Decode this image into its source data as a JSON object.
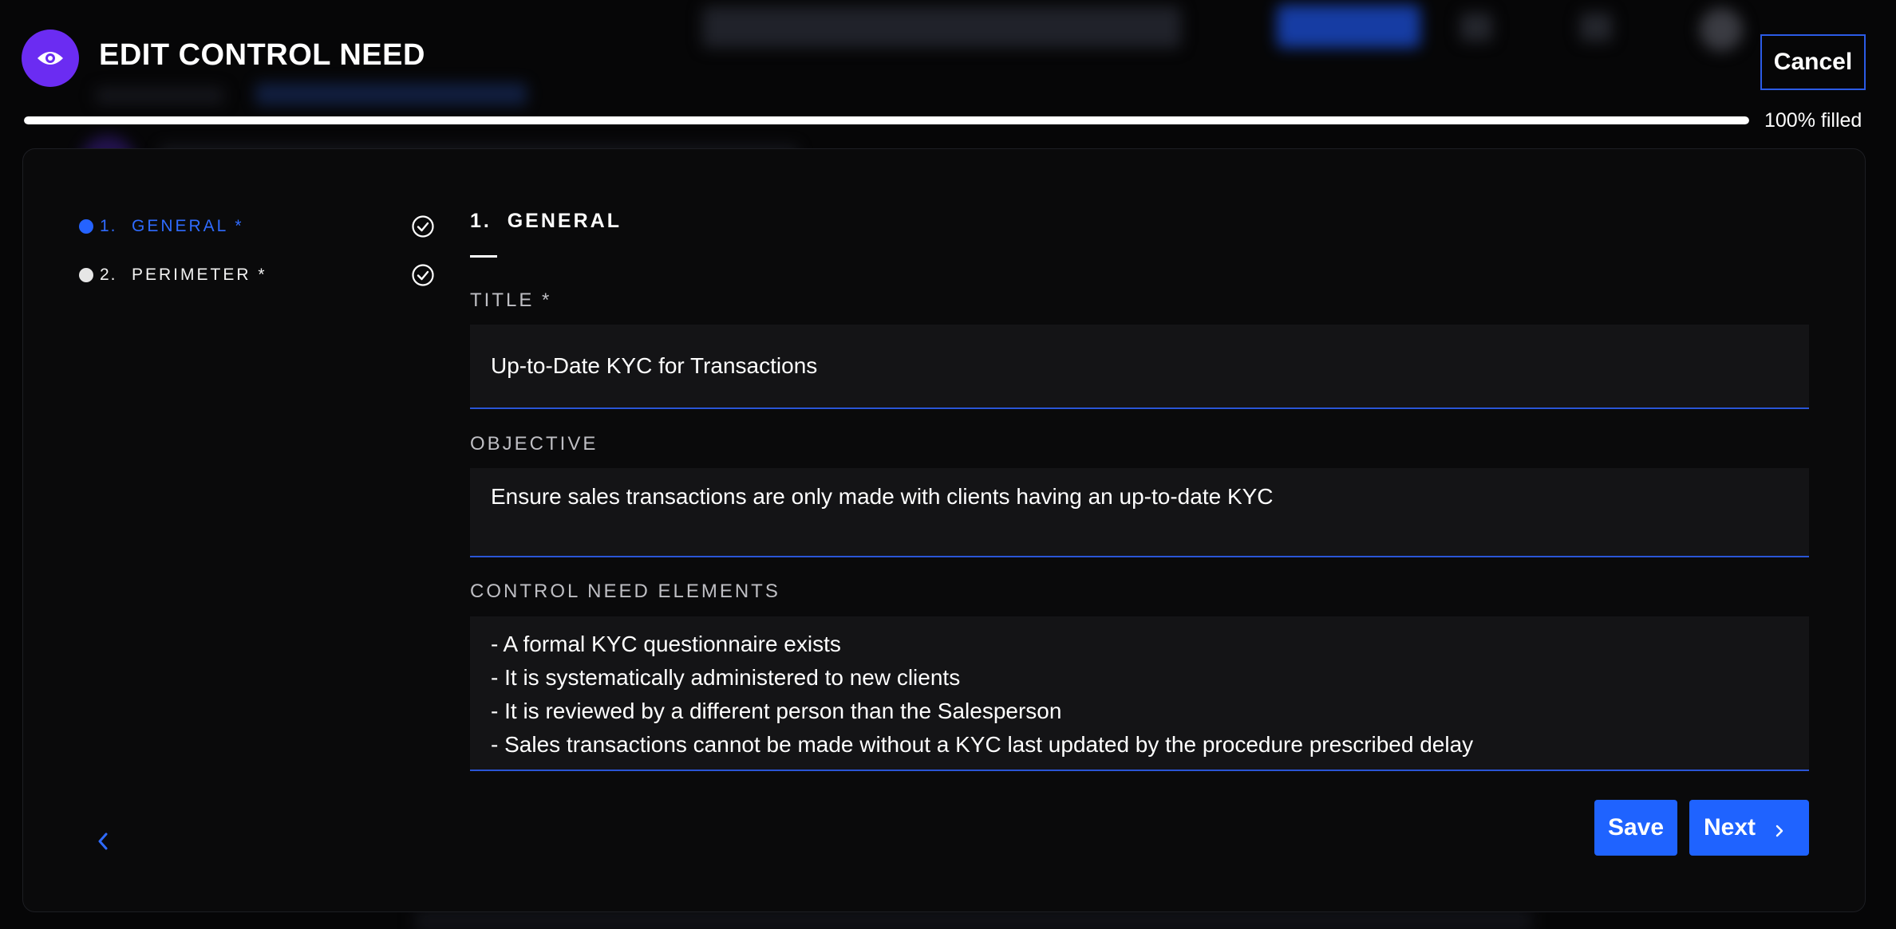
{
  "header": {
    "title": "EDIT CONTROL NEED",
    "icon": "eye-icon",
    "cancel_label": "Cancel"
  },
  "progress": {
    "fraction": 1.0,
    "label": "100% filled"
  },
  "steps": [
    {
      "number": "1.",
      "label": "GENERAL *",
      "active": true,
      "completed": true,
      "icon": "check-circle-icon"
    },
    {
      "number": "2.",
      "label": "PERIMETER *",
      "active": false,
      "completed": true,
      "icon": "check-circle-icon"
    }
  ],
  "section": {
    "title": "1.  GENERAL"
  },
  "fields": {
    "title": {
      "label": "TITLE *",
      "value": "Up-to-Date KYC for Transactions"
    },
    "objective": {
      "label": "OBJECTIVE",
      "value": "Ensure sales transactions are only made with clients having an up-to-date KYC"
    },
    "elements": {
      "label": "CONTROL NEED ELEMENTS",
      "lines": [
        "- A formal KYC questionnaire exists",
        "- It is systematically administered to new clients",
        "- It is reviewed by a different person than the Salesperson",
        "- Sales transactions cannot be made without a KYC last updated by the procedure prescribed delay"
      ]
    }
  },
  "actions": {
    "back_icon": "chevron-left-icon",
    "save_label": "Save",
    "next_label": "Next",
    "next_icon": "chevron-right-icon"
  },
  "colors": {
    "accent": "#1f63ff",
    "header_icon_bg": "#6b2cf2",
    "panel_bg": "#0a0a0b",
    "field_bg": "#141416"
  }
}
